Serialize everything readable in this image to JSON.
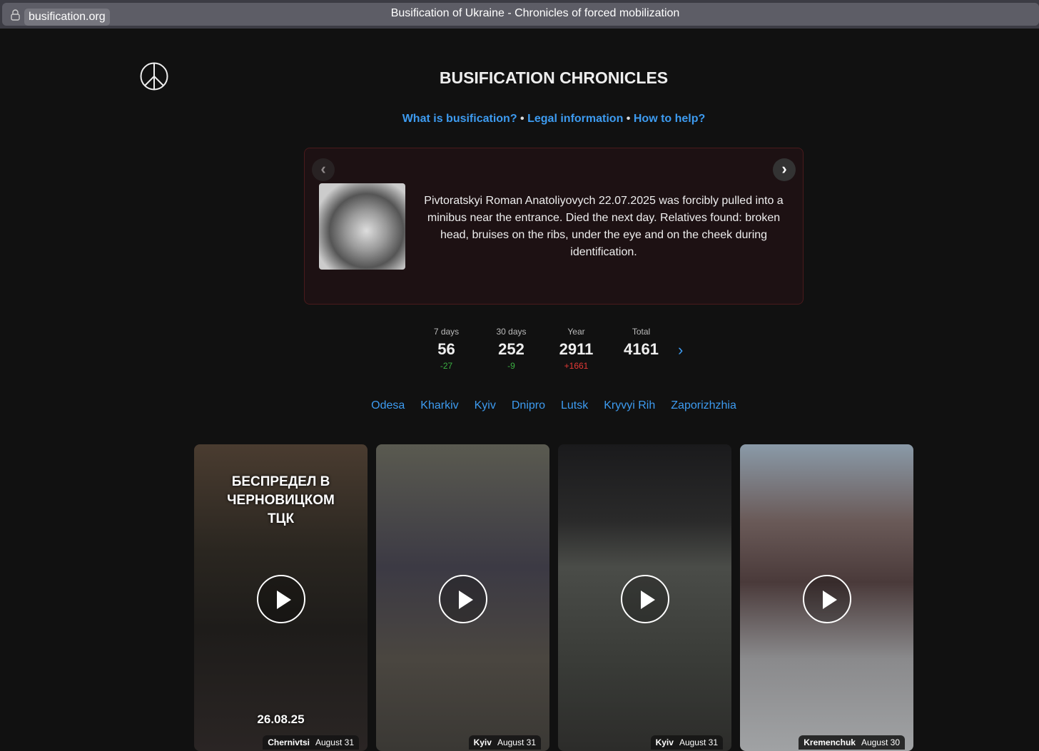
{
  "browser": {
    "url": "busification.org",
    "title": "Busification of Ukraine - Chronicles of forced mobilization"
  },
  "header": {
    "title": "BUSIFICATION CHRONICLES",
    "links": [
      "What is busification?",
      "Legal information",
      "How to help?"
    ],
    "separator": "•"
  },
  "story": {
    "text": "Pivtoratskyi Roman Anatoliyovych 22.07.2025 was forcibly pulled into a minibus near the entrance. Died the next day. Relatives found: broken head, bruises on the ribs, under the eye and on the cheek during identification.",
    "prev": "‹",
    "next": "›"
  },
  "stats": [
    {
      "label": "7 days",
      "value": "56",
      "delta": "-27",
      "delta_color": "#3cb043"
    },
    {
      "label": "30 days",
      "value": "252",
      "delta": "-9",
      "delta_color": "#3cb043"
    },
    {
      "label": "Year",
      "value": "2911",
      "delta": "+1661",
      "delta_color": "#e53935"
    },
    {
      "label": "Total",
      "value": "4161",
      "delta": ""
    }
  ],
  "stats_next": "›",
  "cities": [
    "Odesa",
    "Kharkiv",
    "Kyiv",
    "Dnipro",
    "Lutsk",
    "Kryvyi Rih",
    "Zaporizhzhia"
  ],
  "videos": [
    {
      "city": "Chernivtsi",
      "date": "August 31",
      "overlay": "БЕСПРЕДЕЛ В ЧЕРНОВИЦКОМ ТЦК",
      "overlay_date": "26.08.25"
    },
    {
      "city": "Kyiv",
      "date": "August 31"
    },
    {
      "city": "Kyiv",
      "date": "August 31"
    },
    {
      "city": "Kremenchuk",
      "date": "August 30"
    }
  ]
}
